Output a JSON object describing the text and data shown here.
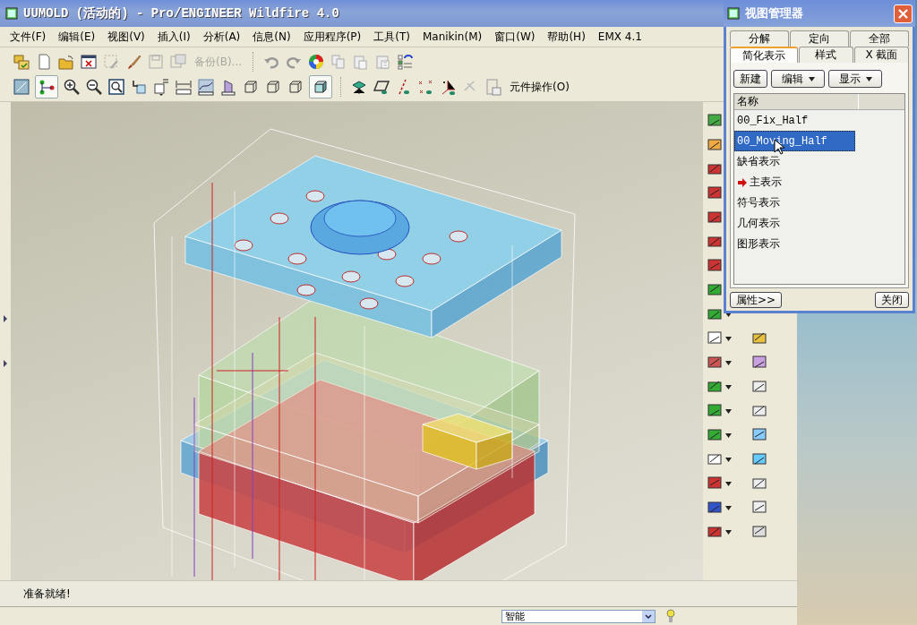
{
  "window": {
    "title": "UUMOLD (活动的) - Pro/ENGINEER Wildfire 4.0"
  },
  "menu": [
    "文件(F)",
    "编辑(E)",
    "视图(V)",
    "插入(I)",
    "分析(A)",
    "信息(N)",
    "应用程序(P)",
    "工具(T)",
    "Manikin(M)",
    "窗口(W)",
    "帮助(H)",
    "EMX 4.1"
  ],
  "toolbar": {
    "backup": {
      "label": "备份(B)...",
      "disabled": true
    },
    "component_operations": {
      "label": "元件操作(O)",
      "disabled": false
    }
  },
  "view_manager": {
    "title": "视图管理器",
    "tab_rows": [
      [
        {
          "label": "分解",
          "selected": false
        },
        {
          "label": "定向",
          "selected": false
        },
        {
          "label": "全部",
          "selected": false
        }
      ],
      [
        {
          "label": "简化表示",
          "selected": true
        },
        {
          "label": "样式",
          "selected": false
        },
        {
          "label": "X 截面",
          "selected": false
        }
      ]
    ],
    "actions": [
      {
        "label": "新建",
        "kind": "button"
      },
      {
        "label": "编辑",
        "kind": "menu"
      },
      {
        "label": "显示",
        "kind": "menu"
      }
    ],
    "column": "名称",
    "items": [
      {
        "label": "00_Fix_Half",
        "selected": false,
        "current": false
      },
      {
        "label": "00_Moving_Half",
        "selected": true,
        "current": false
      },
      {
        "label": "缺省表示",
        "selected": false,
        "current": false
      },
      {
        "label": "主表示",
        "selected": false,
        "current": true
      },
      {
        "label": "符号表示",
        "selected": false,
        "current": false
      },
      {
        "label": "几何表示",
        "selected": false,
        "current": false
      },
      {
        "label": "图形表示",
        "selected": false,
        "current": false
      }
    ],
    "footer_buttons": [
      "属性>>",
      "关闭"
    ]
  },
  "message": "准备就绪!",
  "selection_filter": {
    "value": "智能"
  }
}
